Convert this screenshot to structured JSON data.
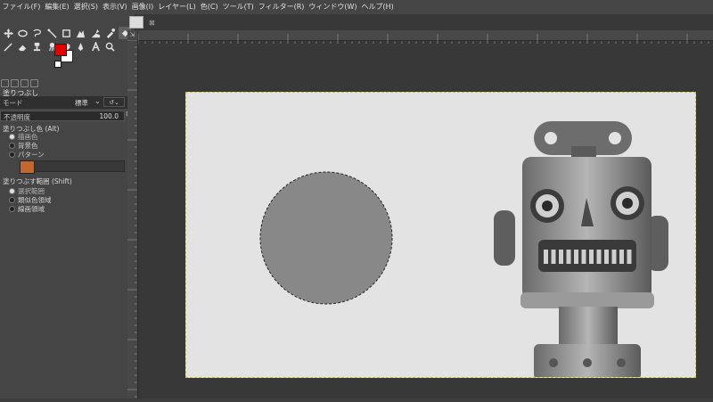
{
  "menubar": {
    "items": [
      "ファイル(F)",
      "編集(E)",
      "選択(S)",
      "表示(V)",
      "画像(I)",
      "レイヤー(L)",
      "色(C)",
      "ツール(T)",
      "フィルター(R)",
      "ウィンドウ(W)",
      "ヘルプ(H)"
    ]
  },
  "toolbox": {
    "row1": [
      "move-icon",
      "ellipse-select-icon",
      "free-select-icon",
      "fuzzy-select-icon",
      "crop-icon",
      "foreground-select-icon",
      "warp-transform-icon",
      "color-picker-icon",
      "bucket-fill-icon"
    ],
    "row2": [
      "paintbrush-icon",
      "eraser-icon",
      "clone-icon",
      "smudge-icon",
      "dodge-burn-icon",
      "path-icon",
      "text-icon",
      "zoom-icon"
    ],
    "fg_color": "#e00000",
    "bg_color": "#ffffff"
  },
  "tool_options": {
    "title": "塗りつぶし",
    "mode_label": "モード",
    "mode_value": "標準",
    "opacity_label": "不透明度",
    "opacity_value": "100.0",
    "fill_type_label": "塗りつぶし色 (Alt)",
    "fill_type_options": [
      "描画色",
      "背景色",
      "パターン"
    ],
    "fill_area_label": "塗りつぶす範囲 (Shift)",
    "fill_area_options": [
      "選択範囲",
      "類似色領域",
      "線画領域"
    ]
  },
  "canvas": {
    "photo_background": "#e3e3e3",
    "circle_fill": "#888888"
  }
}
